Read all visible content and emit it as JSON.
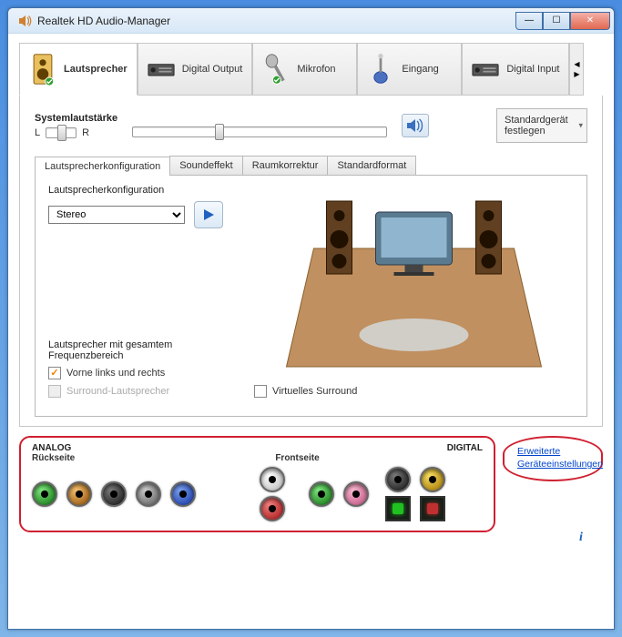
{
  "window": {
    "title": "Realtek HD Audio-Manager"
  },
  "deviceTabs": {
    "speakers": "Lautsprecher",
    "digitalOutput": "Digital Output",
    "microphone": "Mikrofon",
    "input": "Eingang",
    "digitalInput": "Digital Input"
  },
  "systemVolume": {
    "label": "Systemlautstärke",
    "left": "L",
    "right": "R"
  },
  "defaultDevice": {
    "label": "Standardgerät festlegen"
  },
  "configTabs": {
    "speakerConfig": "Lautsprecherkonfiguration",
    "soundEffect": "Soundeffekt",
    "roomCorrection": "Raumkorrektur",
    "defaultFormat": "Standardformat"
  },
  "speakerConfig": {
    "label": "Lautsprecherkonfiguration",
    "selected": "Stereo",
    "freqTitle": "Lautsprecher mit gesamtem Frequenzbereich",
    "frontLR": "Vorne links und rechts",
    "surround": "Surround-Lautsprecher",
    "virtualSurround": "Virtuelles Surround"
  },
  "connectors": {
    "analog": "ANALOG",
    "rear": "Rückseite",
    "front": "Frontseite",
    "digital": "DIGITAL"
  },
  "links": {
    "advanced": "Erweiterte Geräteeinstellungen"
  }
}
